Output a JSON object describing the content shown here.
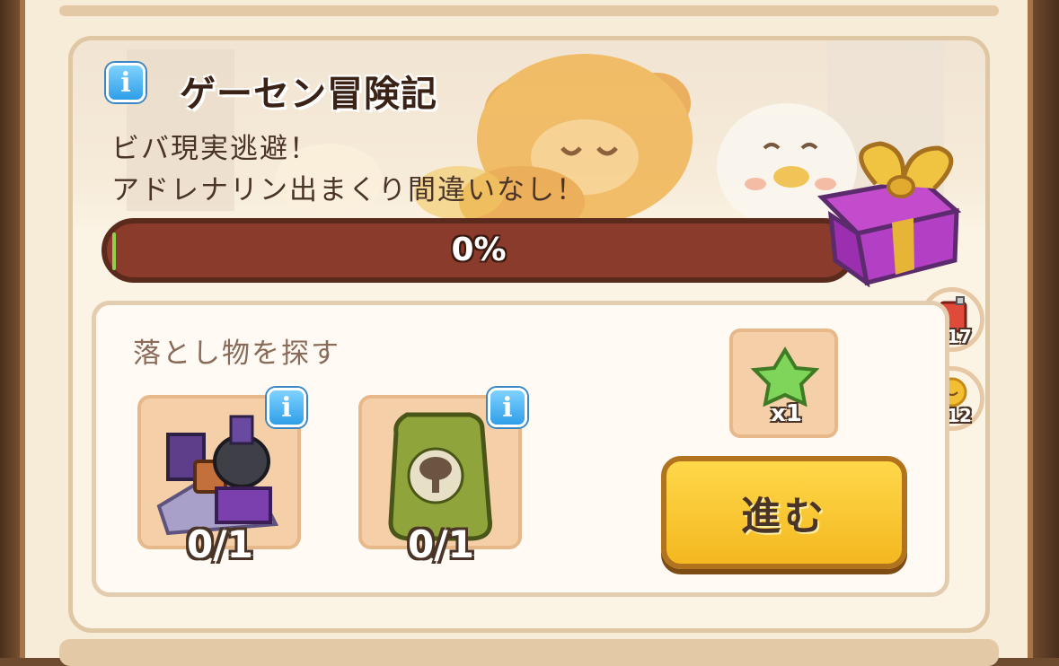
{
  "event": {
    "title": "ゲーセン冒険記",
    "description_line1": "ビバ現実逃避！",
    "description_line2": "アドレナリン出まくり間違いなし！",
    "progress_percent": 0,
    "progress_label": "0%"
  },
  "task": {
    "title": "落とし物を探す",
    "items": [
      {
        "icon": "lost-items-pile-icon",
        "count_label": "0/1"
      },
      {
        "icon": "green-sack-icon",
        "count_label": "0/1"
      }
    ],
    "reward": {
      "icon": "green-star-icon",
      "count_label": "x1"
    },
    "go_button_label": "進む"
  },
  "side_resources": [
    {
      "icon": "fuel-can-icon",
      "count_label": "x17"
    },
    {
      "icon": "sun-token-icon",
      "count_label": "x12"
    }
  ],
  "info_icon_glyph": "i",
  "colors": {
    "progress_track": "#8b3b2b",
    "progress_fill": "#8fd14a",
    "go_button": "#f4b820",
    "info_button": "#2f9ee8"
  }
}
